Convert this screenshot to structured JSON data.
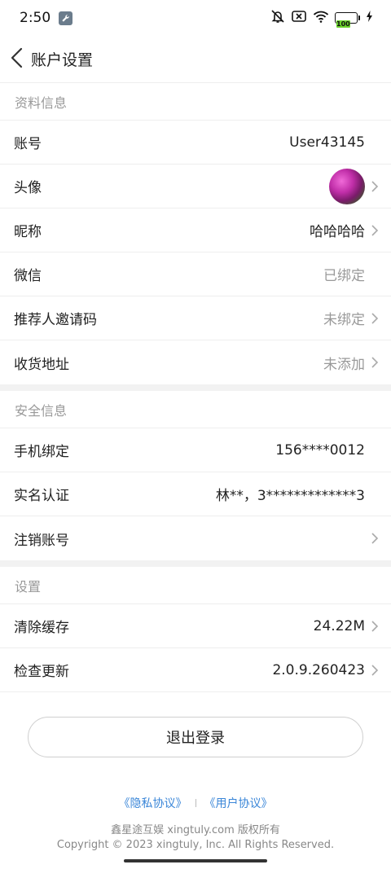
{
  "status": {
    "time": "2:50",
    "battery": "100"
  },
  "header": {
    "title": "账户设置"
  },
  "sections": {
    "profile": {
      "title": "资料信息",
      "account": {
        "label": "账号",
        "value": "User43145"
      },
      "avatar": {
        "label": "头像"
      },
      "nickname": {
        "label": "昵称",
        "value": "哈哈哈哈"
      },
      "wechat": {
        "label": "微信",
        "value": "已绑定"
      },
      "referral": {
        "label": "推荐人邀请码",
        "value": "未绑定"
      },
      "address": {
        "label": "收货地址",
        "value": "未添加"
      }
    },
    "security": {
      "title": "安全信息",
      "phone": {
        "label": "手机绑定",
        "value": "156****0012"
      },
      "realname": {
        "label": "实名认证",
        "value": "林**，3*************3"
      },
      "cancel": {
        "label": "注销账号"
      }
    },
    "settings": {
      "title": "设置",
      "cache": {
        "label": "清除缓存",
        "value": "24.22M"
      },
      "update": {
        "label": "检查更新",
        "value": "2.0.9.260423"
      }
    }
  },
  "logout_label": "退出登录",
  "footer": {
    "privacy": "《隐私协议》",
    "user_agreement": "《用户协议》",
    "company": "鑫星途互娱 xingtuly.com 版权所有",
    "copyright": "Copyright © 2023 xingtuly, Inc. All Rights Reserved."
  },
  "colors": {
    "link": "#3a86d8",
    "muted": "#999999",
    "battery": "#6ad12b"
  }
}
